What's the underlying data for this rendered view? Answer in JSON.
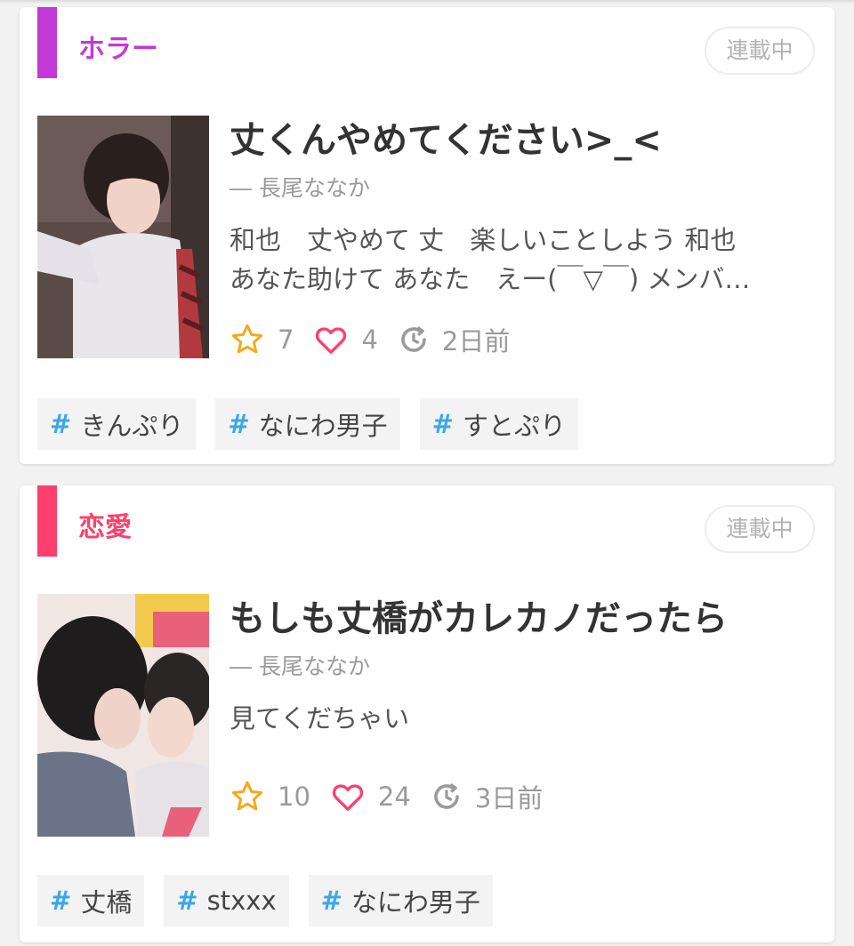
{
  "colors": {
    "horror": "#c23ad6",
    "romance": "#ff3f6d",
    "star": "#f5a91d",
    "heart": "#ff3f6d",
    "hash": "#3aa8e6"
  },
  "stories": [
    {
      "genre": "ホラー",
      "status": "連載中",
      "title": "丈くんやめてください>_<",
      "author": "― 長尾ななか",
      "description_lines": [
        "和也　丈やめて 丈　楽しいことしよう 和也",
        "あなた助けて あなた　えー(￣▽￣) メンバ…"
      ],
      "stars": "7",
      "likes": "4",
      "updated": "2日前",
      "tags": [
        "きんぷり",
        "なにわ男子",
        "すとぷり"
      ]
    },
    {
      "genre": "恋愛",
      "status": "連載中",
      "title": "もしも丈橋がカレカノだったら",
      "author": "― 長尾ななか",
      "description_lines": [
        "見てくだちゃい"
      ],
      "stars": "10",
      "likes": "24",
      "updated": "3日前",
      "tags": [
        "丈橋",
        "stxxx",
        "なにわ男子"
      ]
    }
  ],
  "tag_prefix": "#",
  "icons": {
    "star": "star-icon",
    "heart": "heart-icon",
    "updated": "refresh-clock-icon"
  }
}
